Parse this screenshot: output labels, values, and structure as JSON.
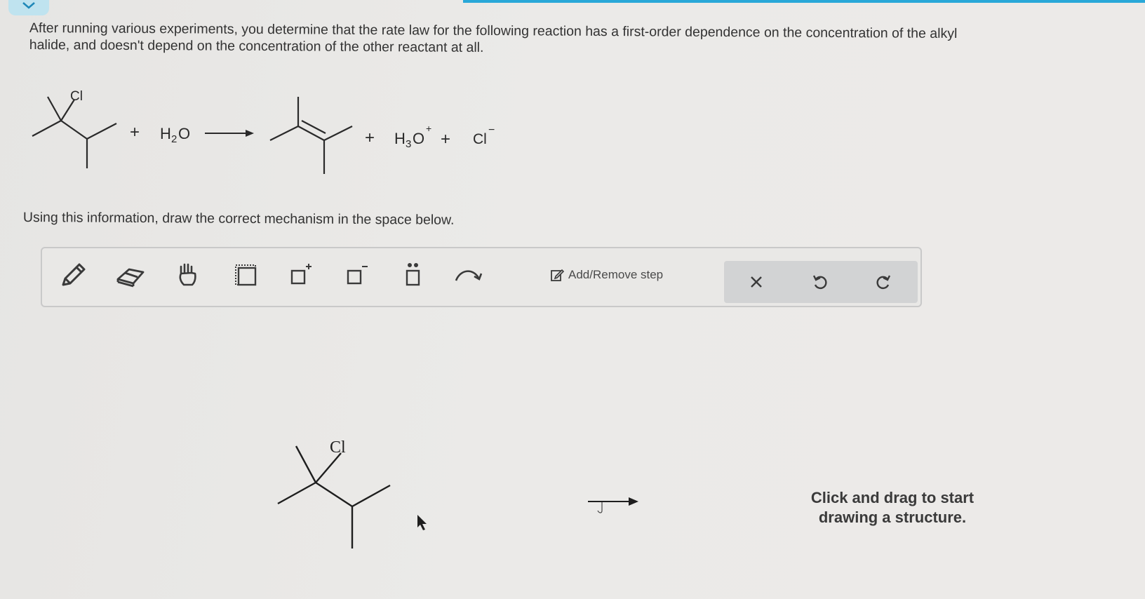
{
  "question": {
    "line1": "After running various experiments, you determine that the rate law for the following reaction has a first-order dependence on the concentration of the alkyl",
    "line2": "halide, and doesn't depend on the concentration of the other reactant at all."
  },
  "reaction": {
    "reactant_label": "Cl",
    "plus1": "+",
    "water_H": "H",
    "water_sub": "2",
    "water_O": "O",
    "plus2": "+",
    "hydronium_H": "H",
    "hydronium_sub": "3",
    "hydronium_O": "O",
    "hydronium_charge": "+",
    "plus3": "+",
    "chloride": "Cl",
    "chloride_charge": "−"
  },
  "instruction": "Using this information, draw the correct mechanism in the space below.",
  "toolbar": {
    "tools": [
      "pencil-icon",
      "eraser-icon",
      "hand-icon",
      "selection-icon",
      "positive-charge-icon",
      "negative-charge-icon",
      "lone-pair-icon",
      "curved-arrow-icon"
    ],
    "add_remove_step": "Add/Remove step",
    "actions": [
      "clear-icon",
      "undo-icon",
      "redo-icon"
    ]
  },
  "canvas": {
    "molecule_label": "Cl",
    "hint_line1": "Click and drag to start",
    "hint_line2": "drawing a structure."
  },
  "colors": {
    "accent": "#29a8d8",
    "toolbar_bg": "#e9e8e6",
    "action_group_bg": "#d2d3d4"
  }
}
